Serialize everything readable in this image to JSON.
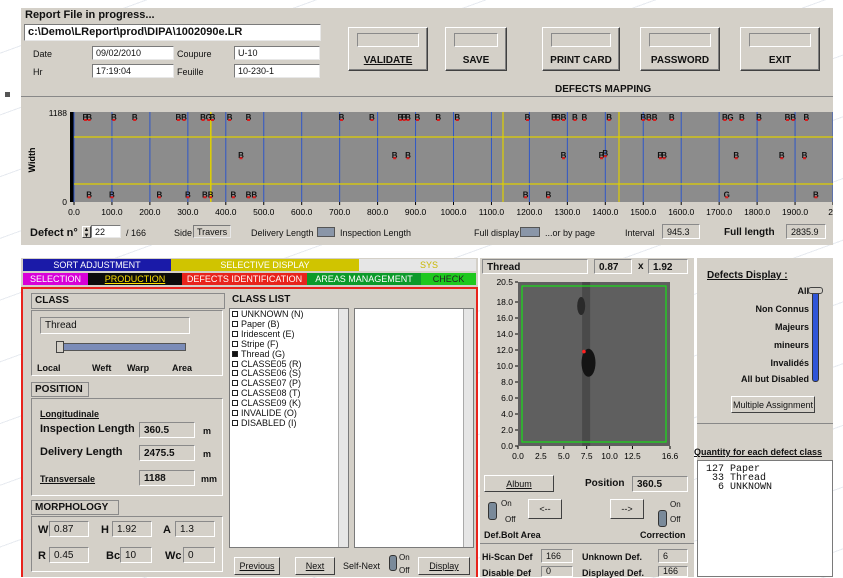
{
  "header": {
    "title": "Report File in progress...",
    "file_path": "c:\\Demo\\LReport\\prod\\DIPA\\1002090e.LR",
    "date_label": "Date",
    "date_value": "09/02/2010",
    "hr_label": "Hr",
    "hr_value": "17:19:04",
    "coupure_label": "Coupure",
    "coupure_value": "U-10",
    "feuille_label": "Feuille",
    "feuille_value": "10-230-1"
  },
  "toolbar": {
    "validate": "VALIDATE",
    "save": "SAVE",
    "print_card": "PRINT CARD",
    "password": "PASSWORD",
    "exit": "EXIT"
  },
  "mapping": {
    "title": "DEFECTS MAPPING",
    "width_label": "Width",
    "defect_no_label": "Defect n°",
    "defect_no_value": "22",
    "defect_total": "/ 166",
    "side_label": "Side",
    "side_value": "Travers",
    "delivery_length_label": "Delivery Length",
    "inspection_length_label": "Inspection Length",
    "full_display_label": "Full display",
    "or_by_page_label": "...or by page",
    "interval_label": "Interval",
    "interval_value": "945.3",
    "full_length_label": "Full length",
    "full_length_value": "2835.9"
  },
  "tabs": {
    "row1": [
      "SORT ADJUSTMENT",
      "SELECTIVE DISPLAY",
      "SYS"
    ],
    "row2": [
      "SELECTION",
      "PRODUCTION",
      "DEFECTS IDENTIFICATION",
      "AREAS MANAGEMENT",
      "CHECK"
    ]
  },
  "class_panel": {
    "class_header": "CLASS",
    "class_value": "Thread",
    "slider_labels": [
      "Local",
      "Weft",
      "Warp",
      "Area"
    ],
    "position_header": "POSITION",
    "longitudinale_label": "Longitudinale",
    "inspection_length_label": "Inspection Length",
    "inspection_length_value": "360.5",
    "inspection_length_unit": "m",
    "delivery_length_label": "Delivery Length",
    "delivery_length_value": "2475.5",
    "delivery_length_unit": "m",
    "transversale_label": "Transversale",
    "transversale_value": "1188",
    "transversale_unit": "mm",
    "morphology_header": "MORPHOLOGY",
    "w_label": "W",
    "w_value": "0.87",
    "h_label": "H",
    "h_value": "1.92",
    "a_label": "A",
    "a_value": "1.3",
    "r_label": "R",
    "r_value": "0.45",
    "bc_label": "Bc",
    "bc_value": "10",
    "wc_label": "Wc",
    "wc_value": "0"
  },
  "class_list": {
    "header": "CLASS LIST",
    "items": [
      {
        "label": "UNKNOWN (N)",
        "checked": false
      },
      {
        "label": "Paper (B)",
        "checked": false
      },
      {
        "label": "Iridescent (E)",
        "checked": false
      },
      {
        "label": "Stripe (F)",
        "checked": false
      },
      {
        "label": "Thread (G)",
        "checked": true
      },
      {
        "label": "CLASSE05 (R)",
        "checked": false
      },
      {
        "label": "CLASSE06 (S)",
        "checked": false
      },
      {
        "label": "CLASSE07 (P)",
        "checked": false
      },
      {
        "label": "CLASSE08 (T)",
        "checked": false
      },
      {
        "label": "CLASSE09 (K)",
        "checked": false
      },
      {
        "label": "INVALIDE (O)",
        "checked": false
      },
      {
        "label": "DISABLED (I)",
        "checked": false
      }
    ],
    "previous": "Previous",
    "next": "Next",
    "self_next": "Self-Next",
    "on": "On",
    "off": "Off",
    "display": "Display"
  },
  "zoom": {
    "class_value": "Thread",
    "w_value": "0.87",
    "x_label": "x",
    "h_value": "1.92",
    "album": "Album",
    "position_label": "Position",
    "position_value": "360.5",
    "on": "On",
    "off": "Off",
    "prev_arrow": "<--",
    "next_arrow": "-->",
    "def_bolt_area": "Def.Bolt Area",
    "correction": "Correction",
    "hiscan_label": "Hi-Scan Def",
    "hiscan_value": "166",
    "unknown_label": "Unknown Def.",
    "unknown_value": "6",
    "disable_label": "Disable Def",
    "disable_value": "0",
    "displayed_label": "Displayed Def.",
    "displayed_value": "166"
  },
  "display_panel": {
    "title": "Defects Display :",
    "levels": [
      "All",
      "Non Connus",
      "Majeurs",
      "mineurs",
      "Invalidés",
      "All but Disabled"
    ],
    "multiple_assignment": "Multiple Assignment",
    "quantity_title": "Quantity for each defect class",
    "quantities": [
      "127 Paper",
      " 33 Thread",
      "  6 UNKNOWN"
    ]
  },
  "chart_data": [
    {
      "type": "scatter",
      "name": "defects-mapping",
      "xlim": [
        0,
        2000
      ],
      "ylim": [
        0,
        1188
      ],
      "x_ticks": [
        "0.0",
        "100.0",
        "200.0",
        "300.0",
        "400.0",
        "500.0",
        "600.0",
        "700.0",
        "800.0",
        "900.0",
        "1000.0",
        "1100.0",
        "1200.0",
        "1300.0",
        "1400.0",
        "1500.0",
        "1600.0",
        "1700.0",
        "1800.0",
        "1900.0",
        "20"
      ],
      "y_ticks": [
        "1188",
        "0"
      ],
      "cursor_x": 360.5,
      "points": [
        {
          "x": 30,
          "y": 1188,
          "c": "B"
        },
        {
          "x": 40,
          "y": 1188,
          "c": "B"
        },
        {
          "x": 105,
          "y": 1188,
          "c": "B"
        },
        {
          "x": 160,
          "y": 1188,
          "c": "B"
        },
        {
          "x": 275,
          "y": 1188,
          "c": "B"
        },
        {
          "x": 290,
          "y": 1188,
          "c": "B"
        },
        {
          "x": 340,
          "y": 1188,
          "c": "B"
        },
        {
          "x": 355,
          "y": 1188,
          "c": "G"
        },
        {
          "x": 365,
          "y": 1188,
          "c": "B"
        },
        {
          "x": 410,
          "y": 1188,
          "c": "B"
        },
        {
          "x": 460,
          "y": 1188,
          "c": "B"
        },
        {
          "x": 705,
          "y": 1188,
          "c": "B"
        },
        {
          "x": 785,
          "y": 1188,
          "c": "B"
        },
        {
          "x": 860,
          "y": 1188,
          "c": "B"
        },
        {
          "x": 870,
          "y": 1188,
          "c": "B"
        },
        {
          "x": 880,
          "y": 1188,
          "c": "B"
        },
        {
          "x": 905,
          "y": 1188,
          "c": "B"
        },
        {
          "x": 960,
          "y": 1188,
          "c": "B"
        },
        {
          "x": 1010,
          "y": 1188,
          "c": "B"
        },
        {
          "x": 1195,
          "y": 1188,
          "c": "B"
        },
        {
          "x": 1265,
          "y": 1188,
          "c": "B"
        },
        {
          "x": 1275,
          "y": 1188,
          "c": "B"
        },
        {
          "x": 1290,
          "y": 1188,
          "c": "B"
        },
        {
          "x": 1320,
          "y": 1188,
          "c": "B"
        },
        {
          "x": 1345,
          "y": 1188,
          "c": "B"
        },
        {
          "x": 1410,
          "y": 1188,
          "c": "B"
        },
        {
          "x": 1500,
          "y": 1188,
          "c": "B"
        },
        {
          "x": 1515,
          "y": 1188,
          "c": "B"
        },
        {
          "x": 1530,
          "y": 1188,
          "c": "B"
        },
        {
          "x": 1575,
          "y": 1188,
          "c": "B"
        },
        {
          "x": 1715,
          "y": 1188,
          "c": "B"
        },
        {
          "x": 1730,
          "y": 1188,
          "c": "G"
        },
        {
          "x": 1760,
          "y": 1188,
          "c": "B"
        },
        {
          "x": 1805,
          "y": 1188,
          "c": "B"
        },
        {
          "x": 1880,
          "y": 1188,
          "c": "B"
        },
        {
          "x": 1895,
          "y": 1188,
          "c": "B"
        },
        {
          "x": 1930,
          "y": 1188,
          "c": "B"
        },
        {
          "x": 440,
          "y": 620,
          "c": "B"
        },
        {
          "x": 845,
          "y": 620,
          "c": "B"
        },
        {
          "x": 880,
          "y": 620,
          "c": "B"
        },
        {
          "x": 1290,
          "y": 620,
          "c": "B"
        },
        {
          "x": 1390,
          "y": 620,
          "c": "B"
        },
        {
          "x": 1400,
          "y": 650,
          "c": "B"
        },
        {
          "x": 1545,
          "y": 620,
          "c": "B"
        },
        {
          "x": 1555,
          "y": 620,
          "c": "B"
        },
        {
          "x": 1745,
          "y": 620,
          "c": "B"
        },
        {
          "x": 1865,
          "y": 620,
          "c": "B"
        },
        {
          "x": 1925,
          "y": 620,
          "c": "B"
        },
        {
          "x": 40,
          "y": 40,
          "c": "B"
        },
        {
          "x": 100,
          "y": 40,
          "c": "B"
        },
        {
          "x": 225,
          "y": 40,
          "c": "B"
        },
        {
          "x": 300,
          "y": 40,
          "c": "B"
        },
        {
          "x": 345,
          "y": 40,
          "c": "B"
        },
        {
          "x": 360,
          "y": 40,
          "c": "B"
        },
        {
          "x": 420,
          "y": 40,
          "c": "B"
        },
        {
          "x": 460,
          "y": 40,
          "c": "B"
        },
        {
          "x": 475,
          "y": 40,
          "c": "B"
        },
        {
          "x": 1190,
          "y": 40,
          "c": "B"
        },
        {
          "x": 1250,
          "y": 40,
          "c": "B"
        },
        {
          "x": 1720,
          "y": 40,
          "c": "G"
        },
        {
          "x": 1955,
          "y": 40,
          "c": "B"
        }
      ]
    },
    {
      "type": "scatter",
      "name": "defect-zoom",
      "xlim": [
        0,
        16.6
      ],
      "ylim": [
        0,
        20.5
      ],
      "x_ticks": [
        "0.0",
        "2.5",
        "5.0",
        "7.5",
        "10.0",
        "12.5",
        "16.6"
      ],
      "y_ticks": [
        "20.5",
        "18.0",
        "16.0",
        "14.0",
        "12.0",
        "10.0",
        "8.0",
        "6.0",
        "4.0",
        "2.0",
        "0.0"
      ],
      "points": [
        {
          "x": 7.2,
          "y": 11.8
        }
      ]
    }
  ]
}
